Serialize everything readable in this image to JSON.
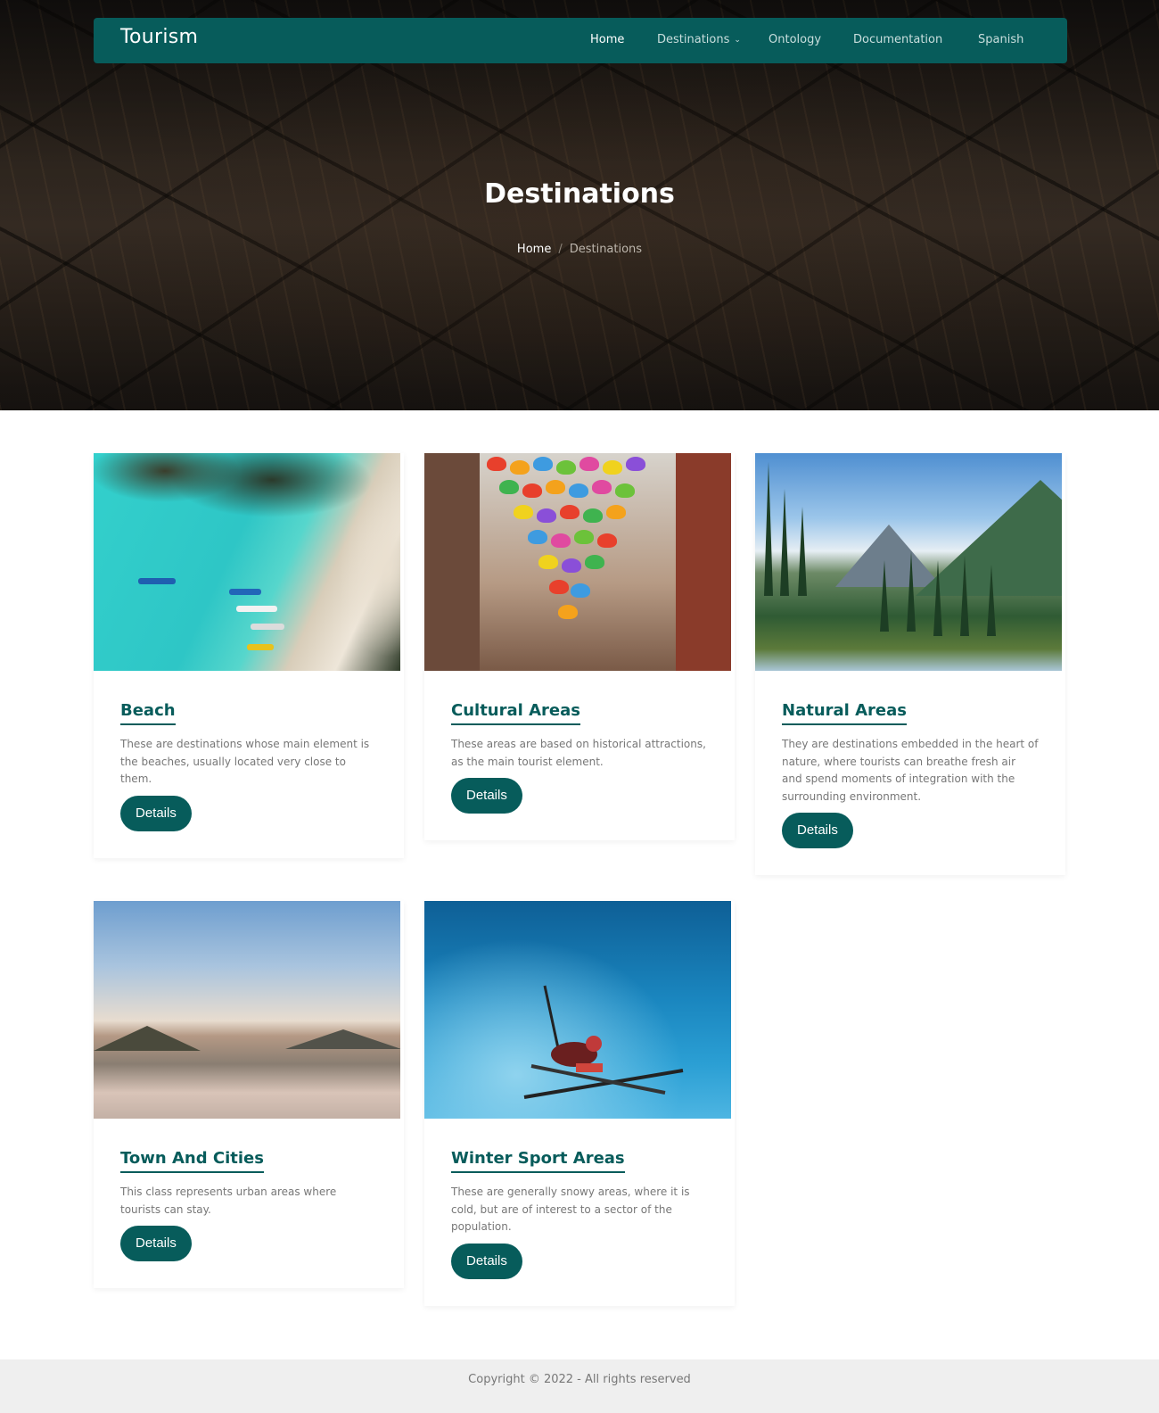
{
  "navbar": {
    "brand": "Tourism",
    "items": [
      {
        "label": "Home"
      },
      {
        "label": "Destinations"
      },
      {
        "label": "Ontology"
      },
      {
        "label": "Documentation"
      },
      {
        "label": "Spanish"
      }
    ]
  },
  "hero": {
    "title": "Destinations",
    "breadcrumb": {
      "home": "Home",
      "separator": "/",
      "current": "Destinations"
    }
  },
  "cards": [
    {
      "title": "Beach",
      "text": "These are destinations whose main element is the beaches, usually located very close to them.",
      "button": "Details"
    },
    {
      "title": "Cultural Areas",
      "text": "These areas are based on historical attractions, as the main tourist element.",
      "button": "Details"
    },
    {
      "title": "Natural Areas",
      "text": "They are destinations embedded in the heart of nature, where tourists can breathe fresh air and spend moments of integration with the surrounding environment.",
      "button": "Details"
    },
    {
      "title": "Town And Cities",
      "text": "This class represents urban areas where tourists can stay.",
      "button": "Details"
    },
    {
      "title": "Winter Sport Areas",
      "text": "These are generally snowy areas, where it is cold, but are of interest to a sector of the population.",
      "button": "Details"
    }
  ],
  "footer": {
    "copyright": "Copyright © 2022 - All rights reserved"
  },
  "colors": {
    "primary": "#075c5b",
    "footer_bg": "#efefef"
  }
}
